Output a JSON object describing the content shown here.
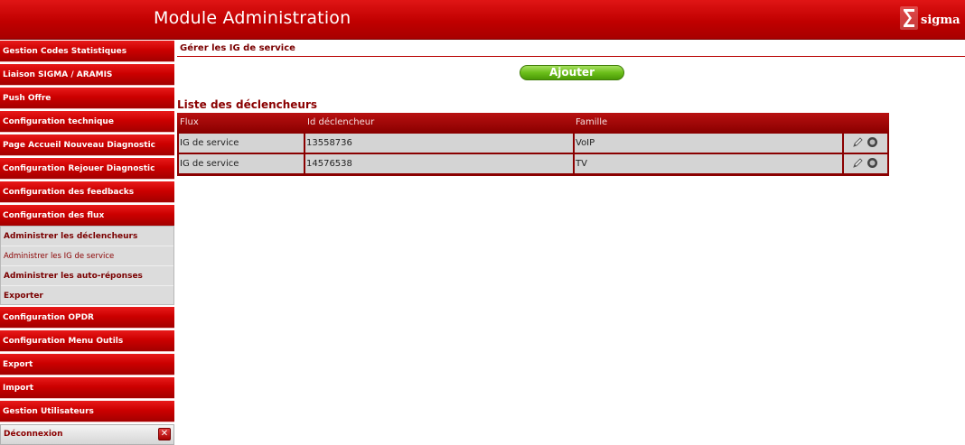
{
  "header": {
    "title": "Module Administration",
    "logo_text": "sigma"
  },
  "sidebar": {
    "items": [
      {
        "label": "Gestion Codes Statistiques"
      },
      {
        "label": "Liaison SIGMA / ARAMIS"
      },
      {
        "label": "Push Offre"
      },
      {
        "label": "Configuration technique"
      },
      {
        "label": "Page Accueil Nouveau Diagnostic"
      },
      {
        "label": "Configuration Rejouer Diagnostic"
      },
      {
        "label": "Configuration des feedbacks"
      },
      {
        "label": "Configuration des flux"
      }
    ],
    "sub_items": [
      {
        "label": "Administrer les déclencheurs"
      },
      {
        "label": "Administrer les IG de service"
      },
      {
        "label": "Administrer les auto-réponses"
      },
      {
        "label": "Exporter"
      }
    ],
    "items_after": [
      {
        "label": "Configuration OPDR"
      },
      {
        "label": "Configuration Menu Outils"
      },
      {
        "label": "Export"
      },
      {
        "label": "Import"
      },
      {
        "label": "Gestion Utilisateurs"
      }
    ],
    "logout_label": "Déconnexion"
  },
  "main": {
    "page_title": "Gérer les IG de service",
    "add_label": "Ajouter",
    "list_title": "Liste des déclencheurs",
    "table": {
      "headers": [
        "Flux",
        "Id déclencheur",
        "Famille"
      ],
      "rows": [
        {
          "flux": "IG de service",
          "id": "13558736",
          "famille": "VoIP"
        },
        {
          "flux": "IG de service",
          "id": "14576538",
          "famille": "TV"
        }
      ]
    }
  },
  "colors": {
    "brand_red": "#c00000",
    "dark_red": "#8a0000",
    "add_green": "#6cbf1a",
    "row_grey": "#d4d4d4"
  },
  "icons": [
    "sigma-logo-icon",
    "close-icon",
    "edit-pencil-icon",
    "delete-circle-icon"
  ]
}
